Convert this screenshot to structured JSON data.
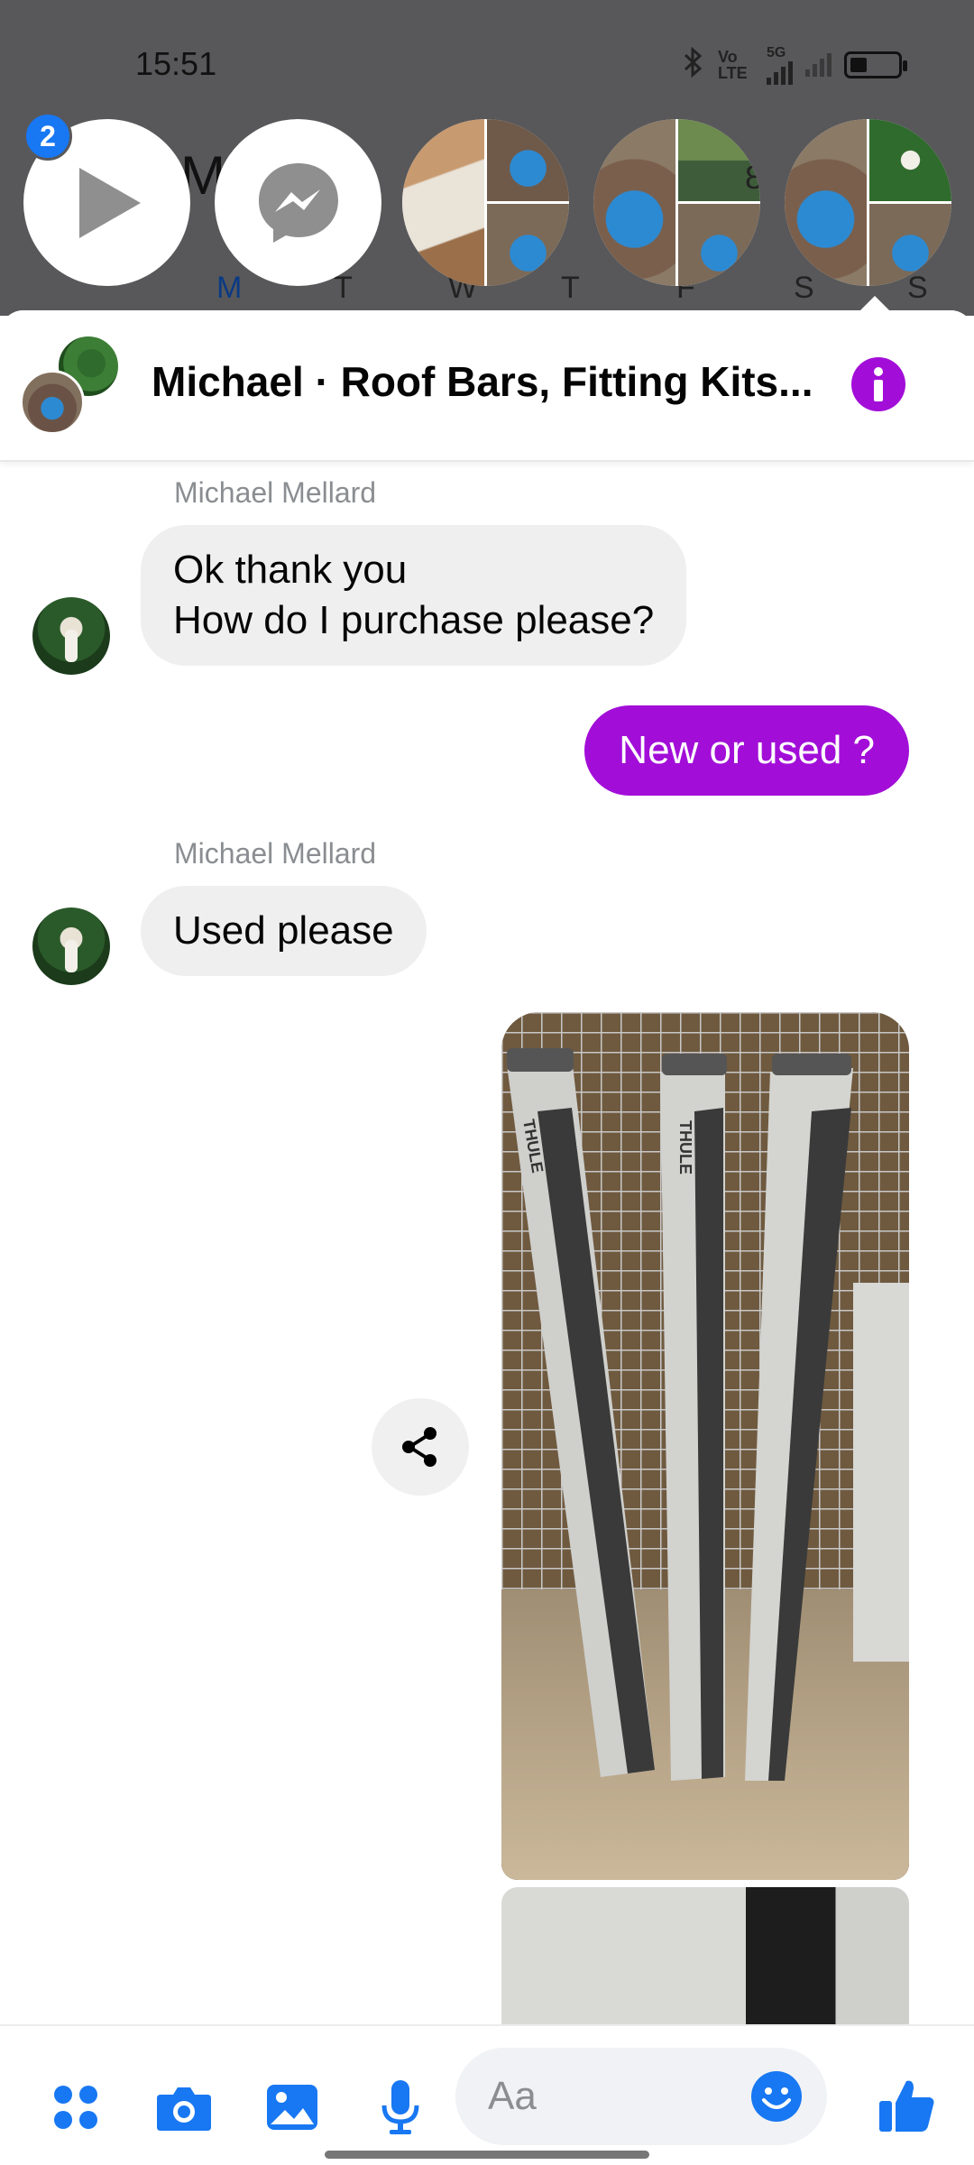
{
  "status_bar": {
    "time": "15:51",
    "network_labels": [
      "Vo LTE",
      "5G"
    ]
  },
  "background_app": {
    "partial_letter": "M",
    "days": [
      "M",
      "T",
      "W",
      "T",
      "F",
      "S",
      "S"
    ],
    "active_day": "M",
    "overlay_count": "8"
  },
  "chat_heads": {
    "unread_badge": "2",
    "items": [
      "play-bubble",
      "messenger-bubble",
      "contact-collage-1",
      "contact-collage-2",
      "contact-collage-3"
    ]
  },
  "header": {
    "title": "Michael · Roof Bars, Fitting Kits...",
    "info_icon": "info-icon",
    "accent_color": "#a20ed8"
  },
  "messages": [
    {
      "direction": "incoming",
      "sender": "Michael Mellard",
      "lines": [
        "Ok thank you",
        "How do I purchase please?"
      ]
    },
    {
      "direction": "outgoing",
      "text": "New or used ?"
    },
    {
      "direction": "incoming",
      "sender": "Michael Mellard",
      "text": "Used please"
    },
    {
      "direction": "outgoing",
      "type": "photo",
      "description_icon": "roof-bars-photo"
    },
    {
      "direction": "outgoing",
      "type": "photo",
      "description_icon": "roof-bar-closeup-photo"
    }
  ],
  "photo_text": "THULE",
  "composer": {
    "placeholder": "Aa",
    "icons": [
      "apps-icon",
      "camera-icon",
      "gallery-icon",
      "microphone-icon",
      "emoji-icon",
      "thumbs-up-icon"
    ],
    "icon_color": "#1877f2"
  }
}
